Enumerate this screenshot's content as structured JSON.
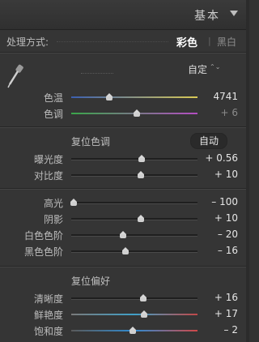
{
  "header": {
    "title": "基本"
  },
  "treatment": {
    "label": "处理方式:",
    "color_option": "彩色",
    "separator": "|",
    "bw_option": "黑白"
  },
  "white_balance": {
    "preset": "自定",
    "preset_arrows": "⌃⌄",
    "sliders": [
      {
        "label": "色温",
        "value": "4741",
        "position": 0.3,
        "track": "temp",
        "dim": false
      },
      {
        "label": "色调",
        "value": "+ 6",
        "position": 0.52,
        "track": "tint",
        "dim": true
      }
    ]
  },
  "tone": {
    "section_label": "复位色调",
    "auto_label": "自动",
    "sliders": [
      {
        "label": "曝光度",
        "value": "+ 0.56",
        "position": 0.56
      },
      {
        "label": "对比度",
        "value": "+ 10",
        "position": 0.55
      }
    ]
  },
  "presence_tone": {
    "sliders": [
      {
        "label": "高光",
        "value": "– 100",
        "position": 0.02
      },
      {
        "label": "阴影",
        "value": "+ 10",
        "position": 0.55
      },
      {
        "label": "白色色阶",
        "value": "– 20",
        "position": 0.41
      },
      {
        "label": "黑色色阶",
        "value": "– 16",
        "position": 0.43
      }
    ]
  },
  "presence": {
    "section_label": "复位偏好",
    "sliders": [
      {
        "label": "清晰度",
        "value": "+ 16",
        "position": 0.57,
        "track": "plain"
      },
      {
        "label": "鲜艳度",
        "value": "+ 17",
        "position": 0.58,
        "track": "vib"
      },
      {
        "label": "饱和度",
        "value": "– 2",
        "position": 0.49,
        "track": "sat"
      }
    ]
  }
}
